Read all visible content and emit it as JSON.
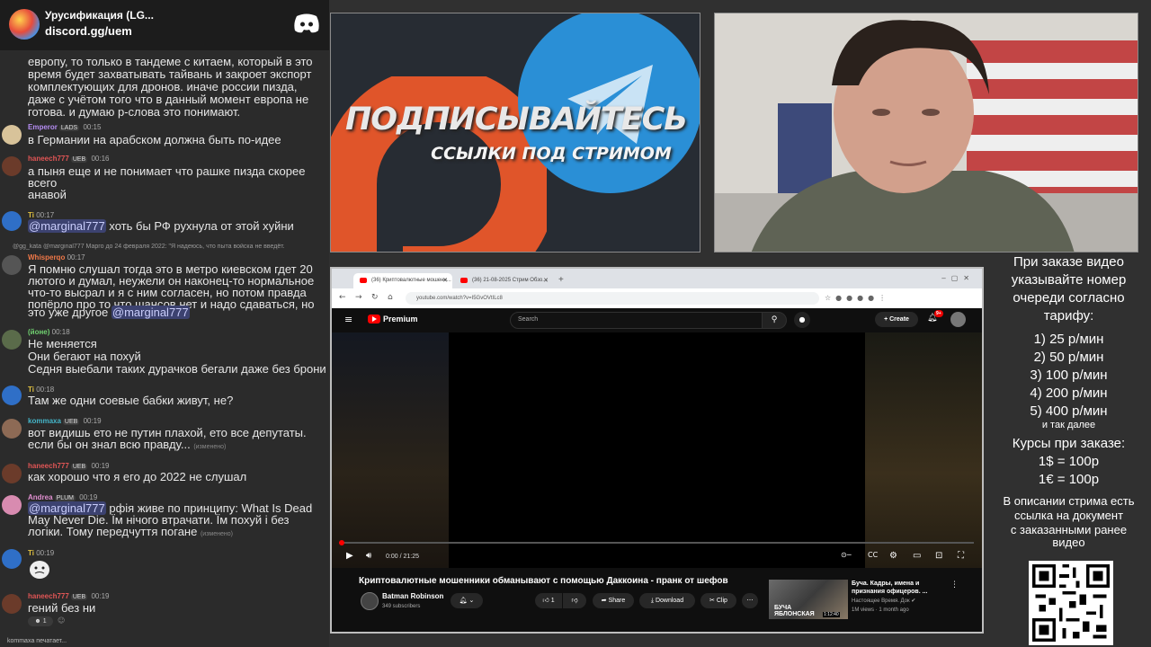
{
  "chat": {
    "server_name": "Урусификация (LG...",
    "server_link": "discord.gg/uem",
    "messages": [
      {
        "lines": [
          "европу, то только в тандеме с китаем, который в это",
          "время будет захватывать тайвань и закроет экспорт",
          "комплектующих для дронов. иначе россии пизда,",
          "даже с учётом того что в данный момент европа не",
          "готова. и думаю р-слова это понимают."
        ]
      },
      {
        "username": "Emperor",
        "badges": "LADS",
        "time": "00:15",
        "color": "#b58df2",
        "lines": [
          "в Германии на арабском должна быть по-идее"
        ]
      },
      {
        "username": "haneech777",
        "badges": "UEB",
        "time": "00:16",
        "color": "#e05555",
        "lines": [
          "а пыня еще и не понимает что рашке пизда скорее",
          "всего",
          "анавой"
        ]
      },
      {
        "username": "Ti",
        "time": "00:17",
        "color": "#e0c040",
        "mention": "@marginal777",
        "lines": [
          " хоть бы РФ рухнула от этой хуйни"
        ]
      },
      {
        "reply": "@gg_kata @marginal777 Марго до 24 февраля 2022: \"Я надеюсь, что пыта войска не введёт.",
        "username": "Whisperqo",
        "time": "00:17",
        "color": "#f07848",
        "lines": [
          "Я помню слушал тогда это в метро киевском гдет 20",
          "лютого и думал, неужели он наконец-то нормальное",
          "что-то высрал и я с ним согласен, но потом правда",
          "попёрло про то что шансов нет и надо сдаваться, но",
          "это уже другое "
        ],
        "mention": "@marginal777"
      },
      {
        "username": "(йоне)",
        "time": "00:18",
        "color": "#70d070",
        "lines": [
          "Не меняется",
          "Они бегают на похуй",
          "Седня выебали таких дурачков бегали даже без брони"
        ]
      },
      {
        "username": "Ti",
        "time": "00:18",
        "color": "#e0c040",
        "lines": [
          "Там же одни соевые бабки живут, не?"
        ]
      },
      {
        "username": "kommaxa",
        "badges": "UEB",
        "time": "00:19",
        "color": "#45b5c8",
        "lines": [
          "вот видишь ето не путин плахой, ето все депутаты.",
          "если бы он знал всю правду..."
        ],
        "edited": "(изменено)"
      },
      {
        "username": "haneech777",
        "badges": "UEB",
        "time": "00:19",
        "color": "#e05555",
        "lines": [
          "как хорошо что я его до 2022 не слушал"
        ]
      },
      {
        "username": "Andrea",
        "badges": "PLUM",
        "time": "00:19",
        "color": "#e08fd0",
        "mention": "@marginal777",
        "lines": [
          " рфія живе по принципу: What Is Dead",
          "May Never Die. Їм нічого втрачати. Їм похуй і без",
          "логіки. Тому передчуття погане "
        ],
        "edited": "(изменено)"
      },
      {
        "username": "Ti",
        "time": "00:19",
        "color": "#e0c040",
        "lines": [
          ""
        ]
      },
      {
        "username": "haneech777",
        "badges": "UEB",
        "time": "00:19",
        "color": "#e05555",
        "lines": [
          "гений без ни"
        ],
        "reaction": "1"
      }
    ],
    "typing": "kommaxa печатает..."
  },
  "promo": {
    "title": "ПОДПИСЫВАЙТЕСЬ",
    "subtitle": "ССЫЛКИ ПОД СТРИМОМ"
  },
  "browser": {
    "tabs": [
      {
        "label": "(36) Криптовалютные мошенн...",
        "active": true
      },
      {
        "label": "(36) 21-08-2025 Стрим Обзо...",
        "active": false
      }
    ],
    "url": "youtube.com/watch?v=I5GvOVtILc8",
    "youtube": {
      "brand": "Premium",
      "search_placeholder": "Search",
      "create_label": "Create",
      "notification_badge": "9+",
      "time_display": "0:00 / 21:25",
      "video_title": "Криптовалютные мошенники обманывают с помощью Даккоина - пранк от шефов",
      "channel_name": "Batman Robinson",
      "subscribers": "349 subscribers",
      "likes": "1",
      "share_label": "Share",
      "download_label": "Download",
      "clip_label": "Clip",
      "recommended": {
        "title": "Буча. Кадры, имена и\nпризнания офицеров. ...",
        "channel": "Настоящее Время. Док",
        "views": "1M views · 1 month ago",
        "thumb_text": "БУЧА\nЯБЛОНСКАЯ",
        "duration": "1:12:40"
      }
    }
  },
  "info": {
    "lines": [
      "При заказе видео",
      "указывайте номер",
      "очереди согласно",
      "тарифу:"
    ],
    "tariffs": [
      "1) 25 р/мин",
      "2) 50 р/мин",
      "3) 100 р/мин",
      "4) 200 р/мин",
      "5) 400 р/мин"
    ],
    "and_more": "и так далее",
    "courses_title": "Курсы при заказе:",
    "rate_usd": "1$ = 100р",
    "rate_eur": "1€ = 100р",
    "description_lines": [
      "В описании стрима есть",
      "ссылка на документ",
      "с заказанными ранее",
      "видео"
    ]
  },
  "colors": {
    "accent_red": "#ff0000",
    "discord_mention_bg": "#3c4270",
    "telegram_blue": "#2a8fd6",
    "promo_orange": "#e0552a"
  }
}
